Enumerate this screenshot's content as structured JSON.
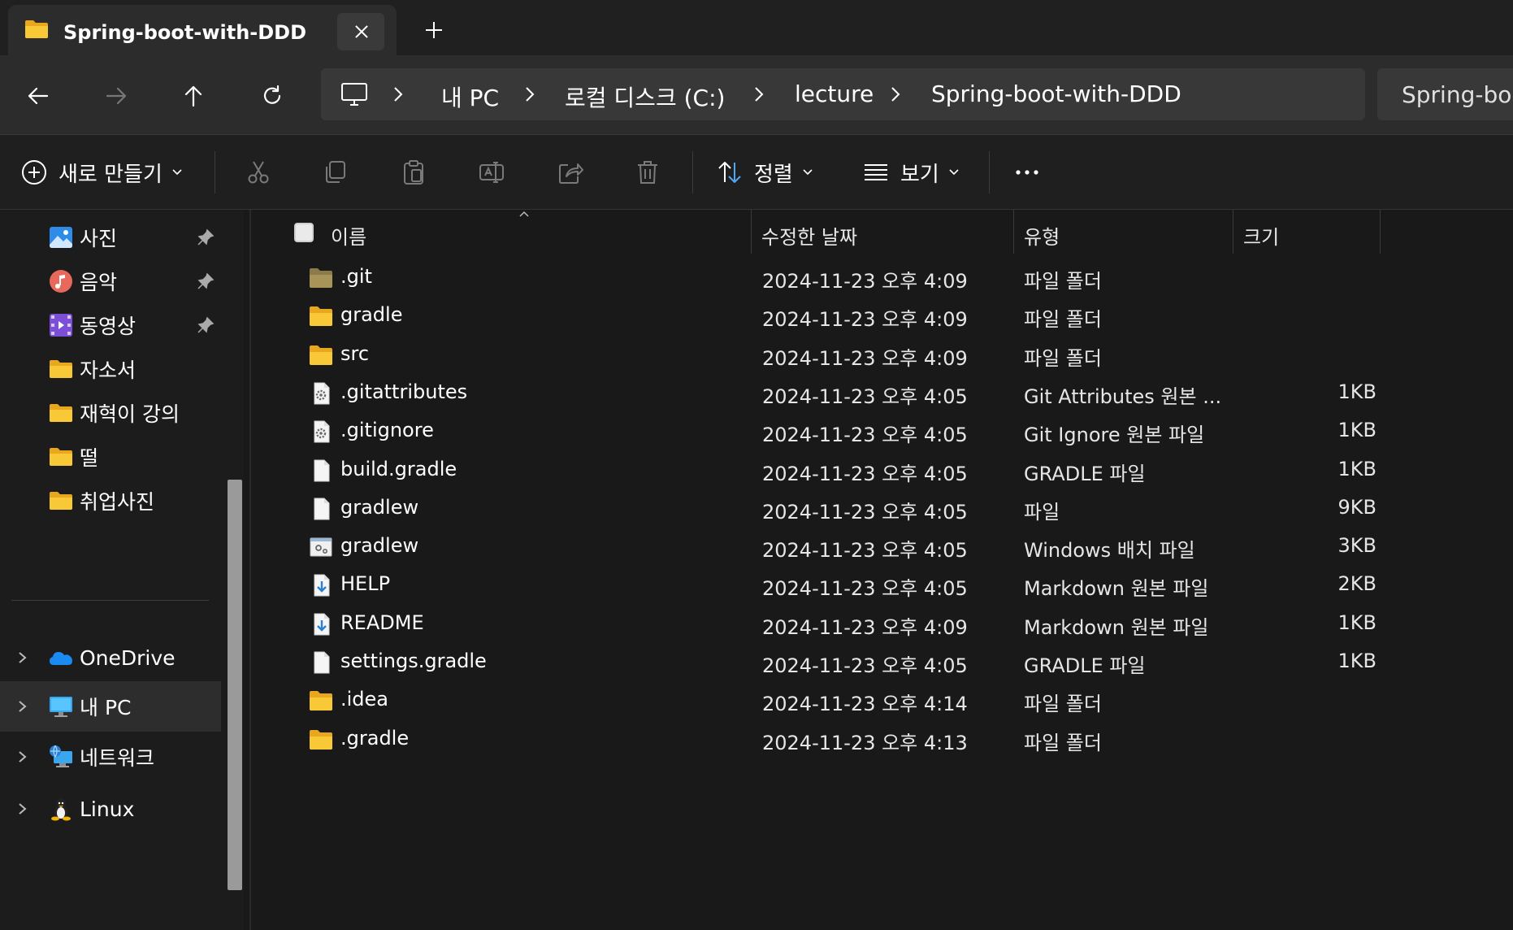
{
  "tab": {
    "title": "Spring-boot-with-DDD",
    "icon": "folder-icon"
  },
  "breadcrumb": [
    {
      "label": "내 PC"
    },
    {
      "label": "로컬 디스크 (C:)"
    },
    {
      "label": "lecture"
    },
    {
      "label": "Spring-boot-with-DDD"
    }
  ],
  "search": {
    "placeholder": "Spring-boot-with-DDD 검색",
    "visible_text": "Spring-boo"
  },
  "toolbar": {
    "new_label": "새로 만들기",
    "sort_label": "정렬",
    "view_label": "보기"
  },
  "sidebar": {
    "quick": [
      {
        "label": "사진",
        "icon": "photos-icon",
        "pinned": true
      },
      {
        "label": "음악",
        "icon": "music-icon",
        "pinned": true
      },
      {
        "label": "동영상",
        "icon": "videos-icon",
        "pinned": true
      },
      {
        "label": "자소서",
        "icon": "folder-icon",
        "pinned": false
      },
      {
        "label": "재혁이 강의",
        "icon": "folder-icon",
        "pinned": false
      },
      {
        "label": "떨",
        "icon": "folder-icon",
        "pinned": false
      },
      {
        "label": "취업사진",
        "icon": "folder-icon",
        "pinned": false
      }
    ],
    "tree": [
      {
        "label": "OneDrive",
        "icon": "onedrive-icon",
        "selected": false
      },
      {
        "label": "내 PC",
        "icon": "pc-icon",
        "selected": true
      },
      {
        "label": "네트워크",
        "icon": "network-icon",
        "selected": false
      },
      {
        "label": "Linux",
        "icon": "linux-icon",
        "selected": false
      }
    ]
  },
  "columns": {
    "name": "이름",
    "date": "수정한 날짜",
    "type": "유형",
    "size": "크기"
  },
  "files": [
    {
      "name": ".git",
      "date": "2024-11-23 오후 4:09",
      "type": "파일 폴더",
      "size": "",
      "icon": "folder-icon-dim"
    },
    {
      "name": "gradle",
      "date": "2024-11-23 오후 4:09",
      "type": "파일 폴더",
      "size": "",
      "icon": "folder-icon"
    },
    {
      "name": "src",
      "date": "2024-11-23 오후 4:09",
      "type": "파일 폴더",
      "size": "",
      "icon": "folder-icon"
    },
    {
      "name": ".gitattributes",
      "date": "2024-11-23 오후 4:05",
      "type": "Git Attributes 원본 ...",
      "size": "1KB",
      "icon": "config-file-icon"
    },
    {
      "name": ".gitignore",
      "date": "2024-11-23 오후 4:05",
      "type": "Git Ignore 원본 파일",
      "size": "1KB",
      "icon": "config-file-icon"
    },
    {
      "name": "build.gradle",
      "date": "2024-11-23 오후 4:05",
      "type": "GRADLE 파일",
      "size": "1KB",
      "icon": "file-icon"
    },
    {
      "name": "gradlew",
      "date": "2024-11-23 오후 4:05",
      "type": "파일",
      "size": "9KB",
      "icon": "file-icon"
    },
    {
      "name": "gradlew",
      "date": "2024-11-23 오후 4:05",
      "type": "Windows 배치 파일",
      "size": "3KB",
      "icon": "batch-file-icon"
    },
    {
      "name": "HELP",
      "date": "2024-11-23 오후 4:05",
      "type": "Markdown 원본 파일",
      "size": "2KB",
      "icon": "markdown-file-icon"
    },
    {
      "name": "README",
      "date": "2024-11-23 오후 4:09",
      "type": "Markdown 원본 파일",
      "size": "1KB",
      "icon": "markdown-file-icon"
    },
    {
      "name": "settings.gradle",
      "date": "2024-11-23 오후 4:05",
      "type": "GRADLE 파일",
      "size": "1KB",
      "icon": "file-icon"
    },
    {
      "name": ".idea",
      "date": "2024-11-23 오후 4:14",
      "type": "파일 폴더",
      "size": "",
      "icon": "folder-icon"
    },
    {
      "name": ".gradle",
      "date": "2024-11-23 오후 4:13",
      "type": "파일 폴더",
      "size": "",
      "icon": "folder-icon"
    }
  ],
  "colors": {
    "folder": "#f4c531",
    "accent": "#4ea6f5",
    "background": "#191919",
    "chrome": "#2c2c2c"
  }
}
